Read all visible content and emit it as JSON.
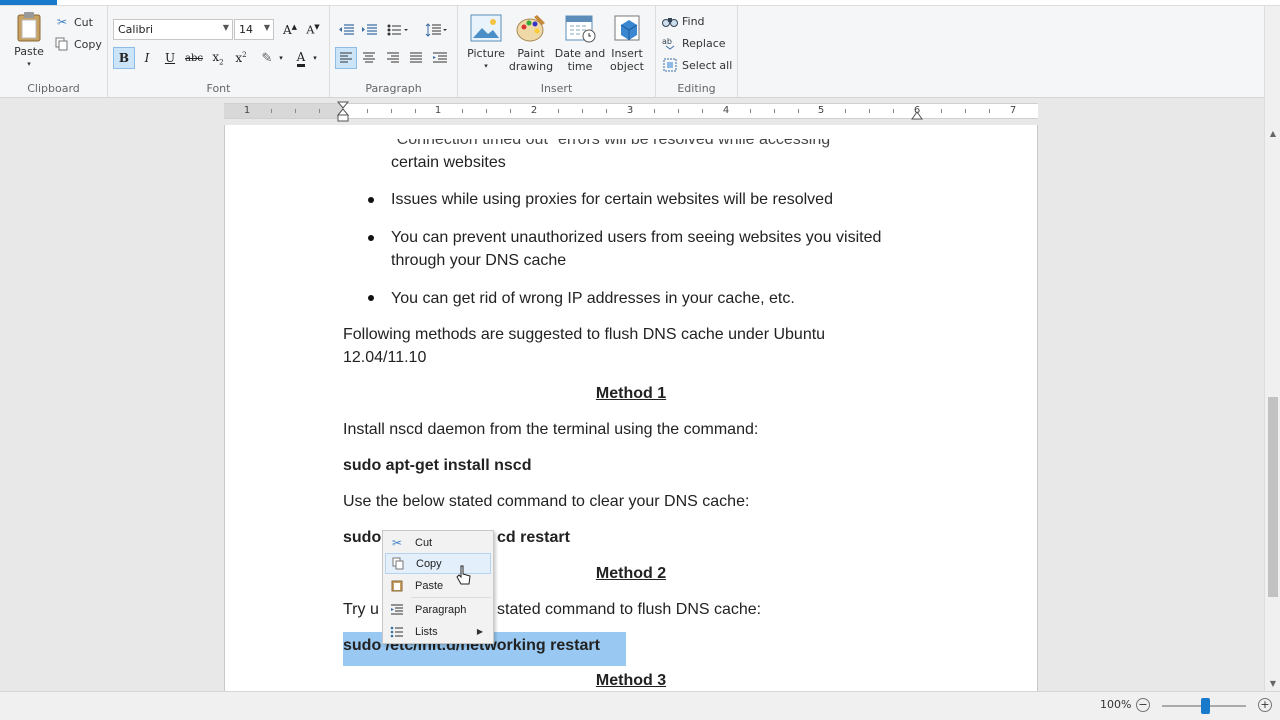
{
  "ribbon": {
    "clipboard": {
      "label": "Clipboard",
      "paste": "Paste",
      "cut": "Cut",
      "copy": "Copy"
    },
    "font": {
      "label": "Font",
      "family": "Calibri",
      "size": "14"
    },
    "paragraph": {
      "label": "Paragraph"
    },
    "insert": {
      "label": "Insert",
      "picture": "Picture",
      "paint_line1": "Paint",
      "paint_line2": "drawing",
      "datetime_line1": "Date and",
      "datetime_line2": "time",
      "object_line1": "Insert",
      "object_line2": "object"
    },
    "editing": {
      "label": "Editing",
      "find": "Find",
      "replace": "Replace",
      "select_all": "Select all"
    }
  },
  "ruler": {
    "numbers": [
      "1",
      "1",
      "2",
      "3",
      "4",
      "5",
      "6",
      "7"
    ]
  },
  "document": {
    "partial_line": "\"Connection timed out\" errors will be resolved while accessing",
    "line1": "certain websites",
    "bullet2": "Issues while using proxies for certain websites will be resolved",
    "bullet3_l1": "You can prevent unauthorized users from seeing websites you visited",
    "bullet3_l2": "through your DNS cache",
    "bullet4": "You can get rid of wrong IP addresses in your cache, etc.",
    "para1_l1": "Following methods are suggested  to flush DNS cache under Ubuntu",
    "para1_l2": "12.04/11.10",
    "method1": "Method 1",
    "install_text": "Install nscd daemon from the terminal using the command:",
    "cmd1": "sudo apt-get install nscd",
    "clear_text": "Use the below stated command  to clear your DNS cache:",
    "cmd2_start": "sudo",
    "cmd2_end": "cd restart",
    "method2": "Method 2",
    "try_start": "Try u",
    "try_end": "stated command to flush DNS cache:",
    "cmd3": "sudo /etc/init.d/networking restart",
    "method3": "Method 3"
  },
  "context_menu": {
    "items": [
      {
        "label": "Cut",
        "icon": "scissors-icon"
      },
      {
        "label": "Copy",
        "icon": "copy-icon"
      },
      {
        "label": "Paste",
        "icon": "paste-icon"
      },
      {
        "label": "Paragraph",
        "icon": "paragraph-icon"
      },
      {
        "label": "Lists",
        "icon": "list-icon"
      }
    ]
  },
  "status": {
    "zoom": "100%"
  },
  "colors": {
    "accent": "#1979ca",
    "selection": "#99c9f2"
  }
}
